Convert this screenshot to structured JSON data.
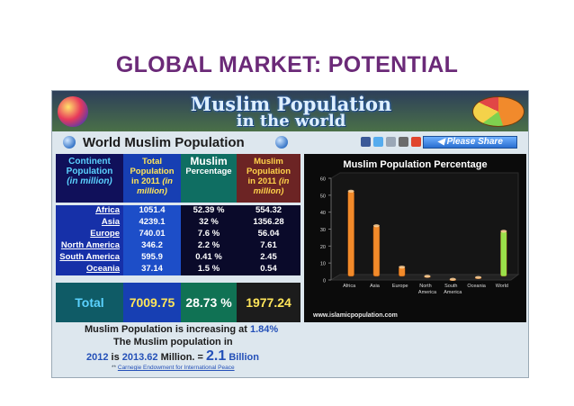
{
  "slide": {
    "title": "GLOBAL MARKET: POTENTIAL"
  },
  "banner": {
    "title_line1": "Muslim Population",
    "title_line2": "in the world"
  },
  "subheader": {
    "title": "World Muslim Population",
    "share_label": "Please Share"
  },
  "table": {
    "headers": {
      "continent": [
        "Continent",
        "Population",
        "(in million)"
      ],
      "total": [
        "Total",
        "Population",
        "in 2011",
        "(in",
        "million)"
      ],
      "percentage": [
        "Muslim",
        "Percentage"
      ],
      "muslim_population": [
        "Muslim",
        "Population",
        "in 2011",
        "(in",
        "million)"
      ]
    },
    "rows": [
      {
        "name": "Africa",
        "total": "1051.4",
        "pct": "52.39 %",
        "mpop": "554.32"
      },
      {
        "name": "Asia",
        "total": "4239.1",
        "pct": "32 %",
        "mpop": "1356.28"
      },
      {
        "name": "Europe",
        "total": "740.01",
        "pct": "7.6 %",
        "mpop": "56.04"
      },
      {
        "name": "North America",
        "total": "346.2",
        "pct": "2.2 %",
        "mpop": "7.61"
      },
      {
        "name": "South America",
        "total": "595.9",
        "pct": "0.41 %",
        "mpop": "2.45"
      },
      {
        "name": "Oceania",
        "total": "37.14",
        "pct": "1.5 %",
        "mpop": "0.54"
      }
    ],
    "total": {
      "label": "Total",
      "total": "7009.75",
      "pct": "28.73 %",
      "mpop": "1977.24"
    }
  },
  "chart_data": {
    "type": "bar",
    "title": "Muslim Population Percentage",
    "categories": [
      "Africa",
      "Asia",
      "Europe",
      "North America",
      "South America",
      "Oceania",
      "World"
    ],
    "values": [
      52.39,
      32,
      7.6,
      2.2,
      0.41,
      1.5,
      28.73
    ],
    "ylim": [
      0,
      60
    ],
    "yticks": [
      0,
      10,
      20,
      30,
      40,
      50,
      60
    ],
    "colors": {
      "bar": "#f28a2a",
      "highlight": "#9be04a"
    },
    "grid": false
  },
  "chart_site": "www.islamicpopulation.com",
  "footer": {
    "line1_prefix": "Muslim Population is increasing at ",
    "line1_rate": "1.84%",
    "line2": "The Muslim population in",
    "line3_year": "2012",
    "line3_is": " is ",
    "line3_value": "2013.62",
    "line3_unit": " Million. = ",
    "line3_big": "2.1",
    "line3_billion": " Billion",
    "source_prefix": "** ",
    "source_link": "Carnegie Endowment for International Peace"
  },
  "share_colors": [
    "#3b5998",
    "#55acee",
    "#9aa7b6",
    "#6b6b6b",
    "#e0452d"
  ]
}
